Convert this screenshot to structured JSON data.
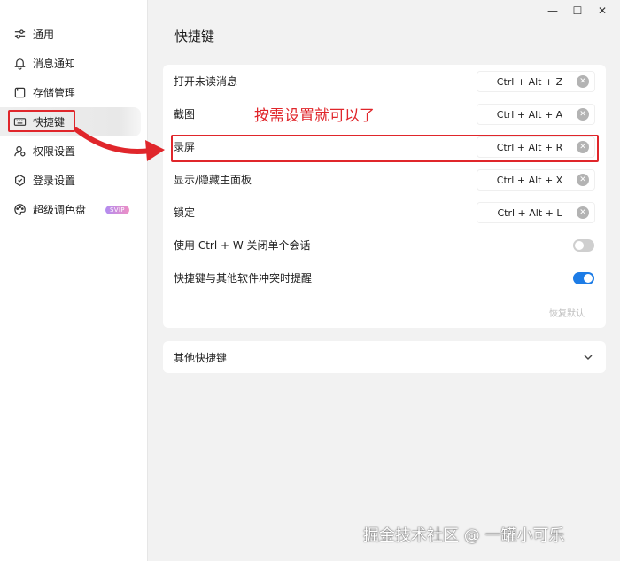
{
  "window": {
    "minimize": "—",
    "maximize": "☐",
    "close": "✕"
  },
  "sidebar": {
    "items": [
      {
        "label": "通用",
        "icon": "sliders-icon"
      },
      {
        "label": "消息通知",
        "icon": "bell-icon"
      },
      {
        "label": "存储管理",
        "icon": "storage-icon"
      },
      {
        "label": "快捷键",
        "icon": "keyboard-icon",
        "active": true
      },
      {
        "label": "权限设置",
        "icon": "user-permission-icon"
      },
      {
        "label": "登录设置",
        "icon": "shield-icon"
      },
      {
        "label": "超级调色盘",
        "icon": "palette-icon",
        "badge": "SVIP"
      }
    ]
  },
  "page": {
    "title": "快捷键"
  },
  "shortcuts": {
    "rows": [
      {
        "label": "打开未读消息",
        "keys": "Ctrl + Alt + Z"
      },
      {
        "label": "截图",
        "keys": "Ctrl + Alt + A"
      },
      {
        "label": "录屏",
        "keys": "Ctrl + Alt + R"
      },
      {
        "label": "显示/隐藏主面板",
        "keys": "Ctrl + Alt + X"
      },
      {
        "label": "锁定",
        "keys": "Ctrl + Alt + L"
      }
    ],
    "toggles": [
      {
        "label": "使用 Ctrl + W 关闭单个会话",
        "on": false
      },
      {
        "label": "快捷键与其他软件冲突时提醒",
        "on": true
      }
    ],
    "restore_label": "恢复默认"
  },
  "other": {
    "label": "其他快捷键"
  },
  "annotation": {
    "text": "按需设置就可以了"
  },
  "watermark": {
    "text": "掘金技术社区 @ 一罐小可乐"
  },
  "colors": {
    "accent": "#1d7ce6",
    "annotation": "#e0262b"
  }
}
